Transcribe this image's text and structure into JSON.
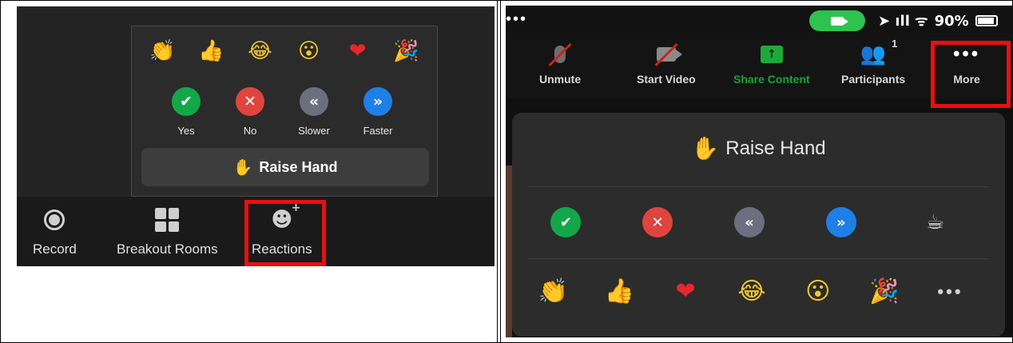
{
  "left_panel": {
    "emojis": [
      {
        "icon": "clapping-hands-icon",
        "glyph": "👏"
      },
      {
        "icon": "thumbs-up-icon",
        "glyph": "👍"
      },
      {
        "icon": "tears-of-joy-icon",
        "glyph": "😂"
      },
      {
        "icon": "surprised-face-icon",
        "glyph": "😮"
      },
      {
        "icon": "heart-icon",
        "glyph": "❤"
      },
      {
        "icon": "party-popper-icon",
        "glyph": "🎉"
      }
    ],
    "feedback": [
      {
        "label": "Yes",
        "glyph": "✔",
        "color": "#12a84a"
      },
      {
        "label": "No",
        "glyph": "✕",
        "color": "#e0443f"
      },
      {
        "label": "Slower",
        "glyph": "«",
        "color": "#6b6f7e"
      },
      {
        "label": "Faster",
        "glyph": "»",
        "color": "#1e7fe6"
      }
    ],
    "raise_hand": {
      "glyph": "✋",
      "label": "Raise Hand"
    },
    "toolbar": {
      "record_label": "Record",
      "breakout_label": "Breakout Rooms",
      "reactions_label": "Reactions",
      "reactions_glyph": "☻",
      "reactions_plus": "+"
    }
  },
  "right_panel": {
    "status": {
      "dots": "•••",
      "signal": "➤ ıll ᯤ",
      "battery": "90%"
    },
    "controls": {
      "unmute_label": "Unmute",
      "start_video_label": "Start Video",
      "share_label": "Share Content",
      "share_glyph": "↑",
      "participants_label": "Participants",
      "participants_glyph": "👥",
      "participants_count": "1",
      "more_label": "More",
      "more_glyph": "•••"
    },
    "sheet": {
      "raise_hand_glyph": "✋",
      "raise_hand_label": "Raise Hand",
      "feedback": [
        {
          "icon": "yes-icon",
          "glyph": "✔",
          "color": "#12a84a"
        },
        {
          "icon": "no-icon",
          "glyph": "✕",
          "color": "#e0443f"
        },
        {
          "icon": "slower-icon",
          "glyph": "«",
          "color": "#6b6f7e"
        },
        {
          "icon": "faster-icon",
          "glyph": "»",
          "color": "#1e7fe6"
        },
        {
          "icon": "coffee-icon",
          "glyph": "☕",
          "color": ""
        }
      ],
      "emojis": [
        {
          "icon": "clapping-hands-icon",
          "glyph": "👏"
        },
        {
          "icon": "thumbs-up-icon",
          "glyph": "👍"
        },
        {
          "icon": "heart-icon",
          "glyph": "❤"
        },
        {
          "icon": "tears-of-joy-icon",
          "glyph": "😂"
        },
        {
          "icon": "surprised-face-icon",
          "glyph": "😮"
        },
        {
          "icon": "party-popper-icon",
          "glyph": "🎉"
        }
      ],
      "more_emoji_glyph": "•••"
    }
  },
  "colors": {
    "highlight": "#e8100e",
    "share_green": "#17a534",
    "camera_green": "#2ec24e"
  }
}
